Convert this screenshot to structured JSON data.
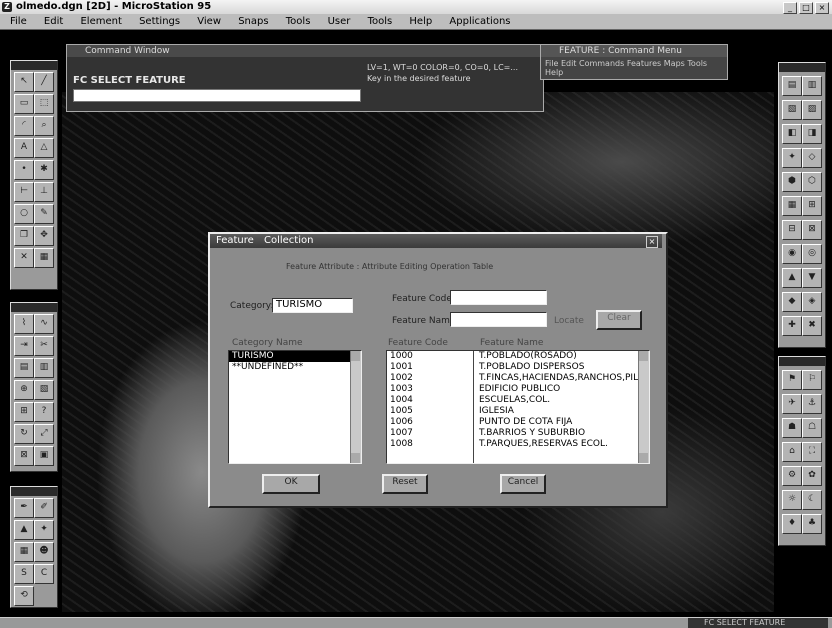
{
  "app": {
    "title": "olmedo.dgn [2D] - MicroStation 95",
    "logo": "Z"
  },
  "menu": [
    "File",
    "Edit",
    "Element",
    "Settings",
    "View",
    "Snaps",
    "Tools",
    "User",
    "Tools",
    "Help",
    "Applications"
  ],
  "command_window": {
    "title": "Command Window",
    "prompt": "FC SELECT FEATURE",
    "message_line1": "LV=1, WT=0 COLOR=0, CO=0, LC=...",
    "message_line2": "Key in the desired feature"
  },
  "command_menu": {
    "title": "FEATURE : Command Menu",
    "items": [
      "File",
      "Edit",
      "Commands",
      "Features",
      "Maps",
      "Tools",
      "Help"
    ]
  },
  "dialog": {
    "menu1": "Feature",
    "menu2": "Collection",
    "header": "Feature Attribute : Attribute Editing Operation Table",
    "category_label": "Category:",
    "category_value": "TURISMO",
    "category_list_header": "Category Name",
    "category_items": [
      "TURISMO",
      "**UNDEFINED**"
    ],
    "feature_code_label": "Feature Code:",
    "feature_name_label": "Feature Name:",
    "locate_label": "Locate",
    "clear_label": "Clear",
    "table_header_code": "Feature Code",
    "table_header_name": "Feature Name",
    "features": [
      {
        "code": "1000",
        "name": "T.POBLADO(ROSADO)"
      },
      {
        "code": "1001",
        "name": "T.POBLADO DISPERSOS"
      },
      {
        "code": "1002",
        "name": "T.FINCAS,HACIENDAS,RANCHOS,PIL"
      },
      {
        "code": "1003",
        "name": "EDIFICIO PUBLICO"
      },
      {
        "code": "1004",
        "name": "ESCUELAS,COL."
      },
      {
        "code": "1005",
        "name": "IGLESIA"
      },
      {
        "code": "1006",
        "name": "PUNTO DE COTA FIJA"
      },
      {
        "code": "1007",
        "name": "T.BARRIOS Y SUBURBIO"
      },
      {
        "code": "1008",
        "name": "T.PARQUES,RESERVAS ECOL."
      }
    ],
    "ok_label": "OK",
    "reset_label": "Reset",
    "cancel_label": "Cancel"
  },
  "status_badge": "FC SELECT FEATURE"
}
